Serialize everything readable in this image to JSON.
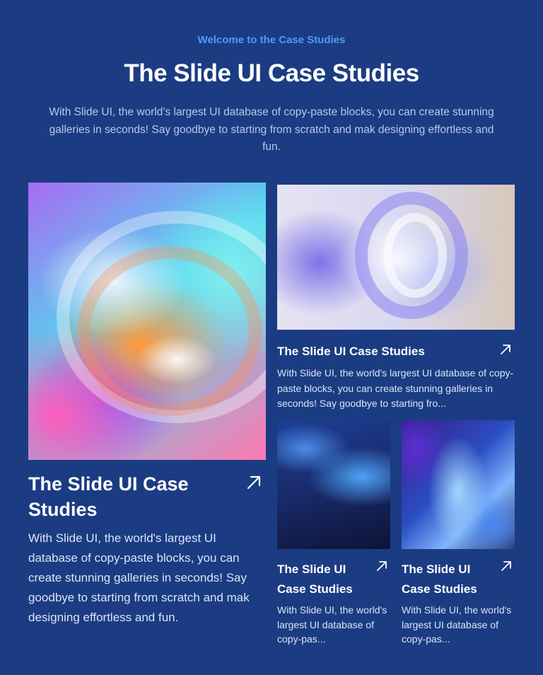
{
  "header": {
    "eyebrow": "Welcome to the Case Studies",
    "title": "The Slide UI Case Studies",
    "intro": "With Slide UI, the world's largest UI database of copy-paste blocks, you can create stunning galleries in seconds! Say goodbye to starting from scratch and mak designing effortless and fun."
  },
  "cards": {
    "large": {
      "title": "The Slide UI Case Studies",
      "text": "With Slide UI, the world's largest UI database of copy-paste blocks, you can create stunning galleries in seconds! Say goodbye to starting from scratch and mak designing effortless and fun."
    },
    "top": {
      "title": "The Slide UI Case Studies",
      "text": "With Slide UI, the world's largest UI database of copy-paste blocks, you can create stunning galleries in seconds! Say goodbye to starting fro..."
    },
    "bottom_left": {
      "title": "The Slide UI Case Studies",
      "text": "With Slide UI, the world's largest UI database of copy-pas..."
    },
    "bottom_right": {
      "title": "The Slide UI Case Studies",
      "text": "With Slide UI, the world's largest UI database of copy-pas..."
    }
  },
  "icons": {
    "card_link": "arrow-up-right-icon"
  },
  "colors": {
    "background": "#1b3c82",
    "accent": "#4f9bf7",
    "muted_text": "#b8c8ea"
  }
}
